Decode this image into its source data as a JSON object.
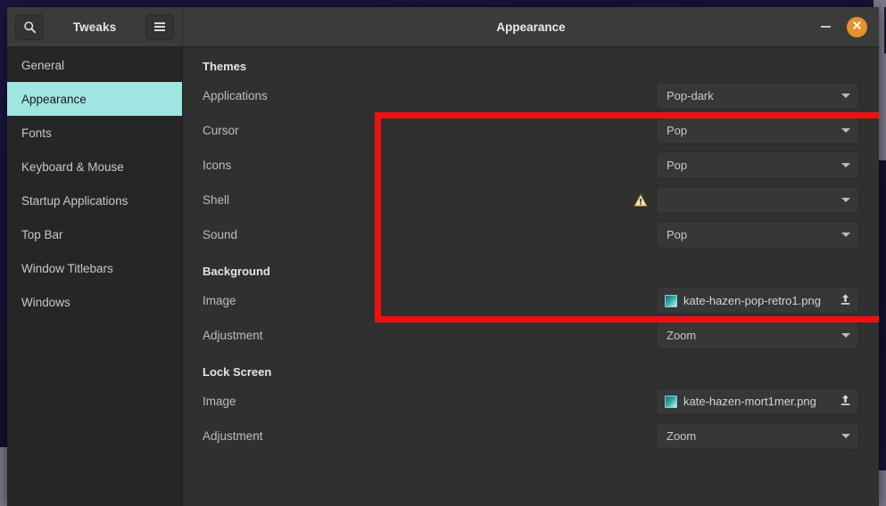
{
  "window": {
    "app_title": "Tweaks",
    "title": "Appearance",
    "search_icon": "search-icon",
    "menu_icon": "hamburger-menu-icon",
    "minimize_icon": "minimize-icon",
    "close_icon": "close-icon",
    "close_button_color": "#e8912a"
  },
  "sidebar": {
    "items": [
      {
        "label": "General",
        "selected": false
      },
      {
        "label": "Appearance",
        "selected": true
      },
      {
        "label": "Fonts",
        "selected": false
      },
      {
        "label": "Keyboard & Mouse",
        "selected": false
      },
      {
        "label": "Startup Applications",
        "selected": false
      },
      {
        "label": "Top Bar",
        "selected": false
      },
      {
        "label": "Window Titlebars",
        "selected": false
      },
      {
        "label": "Windows",
        "selected": false
      }
    ],
    "selected_color": "#9fe5e2"
  },
  "sections": [
    {
      "title": "Themes",
      "rows": [
        {
          "label": "Applications",
          "type": "combo",
          "value": "Pop-dark",
          "warning": false
        },
        {
          "label": "Cursor",
          "type": "combo",
          "value": "Pop",
          "warning": false
        },
        {
          "label": "Icons",
          "type": "combo",
          "value": "Pop",
          "warning": false
        },
        {
          "label": "Shell",
          "type": "combo",
          "value": "",
          "warning": true
        },
        {
          "label": "Sound",
          "type": "combo",
          "value": "Pop",
          "warning": false
        }
      ]
    },
    {
      "title": "Background",
      "rows": [
        {
          "label": "Image",
          "type": "file",
          "value": "kate-hazen-pop-retro1.png",
          "warning": false
        },
        {
          "label": "Adjustment",
          "type": "combo",
          "value": "Zoom",
          "warning": false
        }
      ]
    },
    {
      "title": "Lock Screen",
      "rows": [
        {
          "label": "Image",
          "type": "file",
          "value": "kate-hazen-mort1mer.png",
          "warning": false
        },
        {
          "label": "Adjustment",
          "type": "combo",
          "value": "Zoom",
          "warning": false
        }
      ]
    }
  ],
  "annotation": {
    "highlight_color": "#ee1111",
    "target_section": "Themes"
  }
}
